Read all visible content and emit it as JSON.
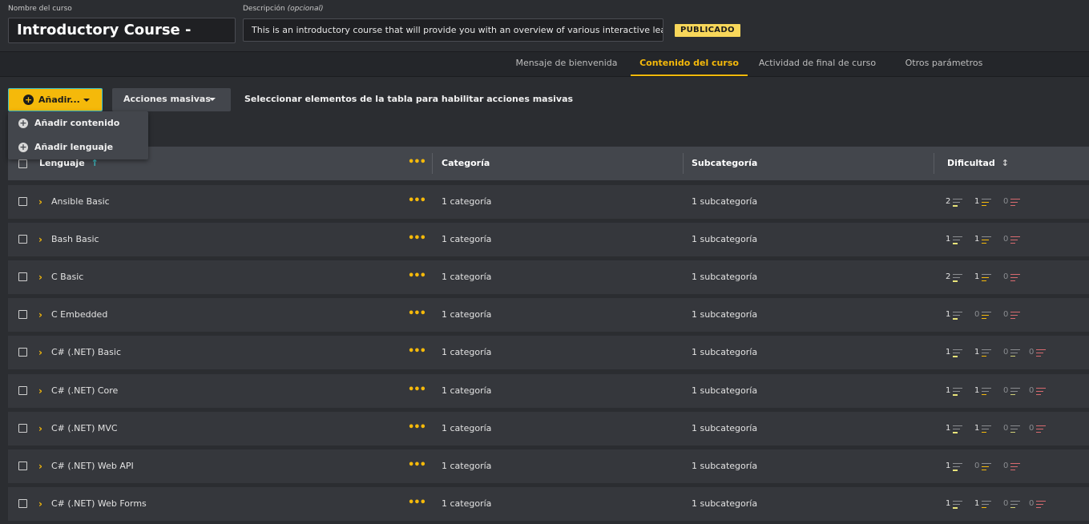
{
  "header": {
    "name_label": "Nombre del curso",
    "name_value": "Introductory Course -",
    "desc_label": "Descripción",
    "desc_optional": "(opcional)",
    "desc_value": "This is an introductory course that will provide you with an overview of various interactive lea...",
    "status_badge": "PUBLICADO"
  },
  "tabs": [
    {
      "label": "Mensaje de bienvenida"
    },
    {
      "label": "Contenido del curso"
    },
    {
      "label": "Actividad de final de curso"
    },
    {
      "label": "Otros parámetros"
    }
  ],
  "active_tab": "Contenido del curso",
  "toolbar": {
    "add_label": "Añadir...",
    "mass_label": "Acciones masivas",
    "hint": "Seleccionar elementos de la tabla para habilitar acciones masivas"
  },
  "dropdown": {
    "items": [
      {
        "label": "Añadir contenido",
        "icon": "plus-circle-icon"
      },
      {
        "label": "Añadir lenguaje",
        "icon": "plus-circle-icon"
      }
    ]
  },
  "table": {
    "columns": {
      "language": "Lenguaje",
      "actions": "•••",
      "category": "Categoría",
      "subcategory": "Subcategoría",
      "difficulty": "Dificultad"
    },
    "rows": [
      {
        "name": "Ansible Basic",
        "category": "1 categoría",
        "subcategory": "1 subcategoría",
        "diff": [
          "2",
          "1",
          "0"
        ]
      },
      {
        "name": "Bash Basic",
        "category": "1 categoría",
        "subcategory": "1 subcategoría",
        "diff": [
          "1",
          "1",
          "0"
        ]
      },
      {
        "name": "C Basic",
        "category": "1 categoría",
        "subcategory": "1 subcategoría",
        "diff": [
          "2",
          "1",
          "0"
        ]
      },
      {
        "name": "C Embedded",
        "category": "1 categoría",
        "subcategory": "1 subcategoría",
        "diff": [
          "1",
          "0",
          "0"
        ]
      },
      {
        "name": "C# (.NET) Basic",
        "category": "1 categoría",
        "subcategory": "1 subcategoría",
        "diff": [
          "1",
          "1",
          "0",
          "0"
        ]
      },
      {
        "name": "C# (.NET) Core",
        "category": "1 categoría",
        "subcategory": "1 subcategoría",
        "diff": [
          "1",
          "1",
          "0",
          "0"
        ]
      },
      {
        "name": "C# (.NET) MVC",
        "category": "1 categoría",
        "subcategory": "1 subcategoría",
        "diff": [
          "1",
          "1",
          "0",
          "0"
        ]
      },
      {
        "name": "C# (.NET) Web API",
        "category": "1 categoría",
        "subcategory": "1 subcategoría",
        "diff": [
          "1",
          "0",
          "0"
        ]
      },
      {
        "name": "C# (.NET) Web Forms",
        "category": "1 categoría",
        "subcategory": "1 subcategoría",
        "diff": [
          "1",
          "1",
          "0",
          "0"
        ]
      }
    ]
  },
  "colors": {
    "accent": "#f5b90a",
    "sort_active": "#3cc1c7",
    "hard": "#d76a6f"
  }
}
